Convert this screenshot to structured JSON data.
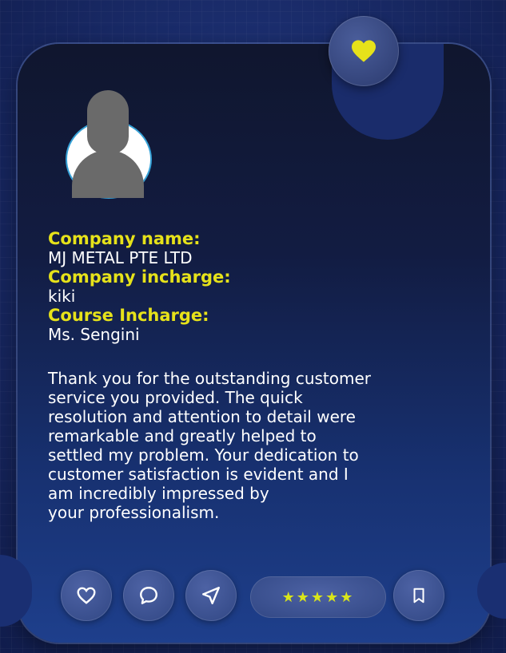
{
  "profile": {
    "company_name_label": "Company name:",
    "company_name": "MJ METAL PTE LTD",
    "company_incharge_label": "Company incharge:",
    "company_incharge": "kiki",
    "course_incharge_label": "Course Incharge:",
    "course_incharge": "Ms. Sengini"
  },
  "message": {
    "lines": [
      "Thank you for the outstanding customer",
      "service you provided. The quick",
      "resolution and attention to detail were",
      "remarkable and greatly helped to",
      "settled my problem.  Your dedication to",
      "customer satisfaction is evident and I",
      "am incredibly impressed by",
      "your professionalism."
    ]
  },
  "rating": {
    "value": 5,
    "max": 5,
    "stars_text": "★★★★★"
  },
  "icons": {
    "badge": "heart-filled-icon",
    "like": "heart-outline-icon",
    "comment": "comment-icon",
    "share": "send-icon",
    "bookmark": "bookmark-icon"
  },
  "colors": {
    "accent_yellow": "#e6e21a",
    "card_bg": "#10162e",
    "page_bg": "#1a2c6b"
  }
}
